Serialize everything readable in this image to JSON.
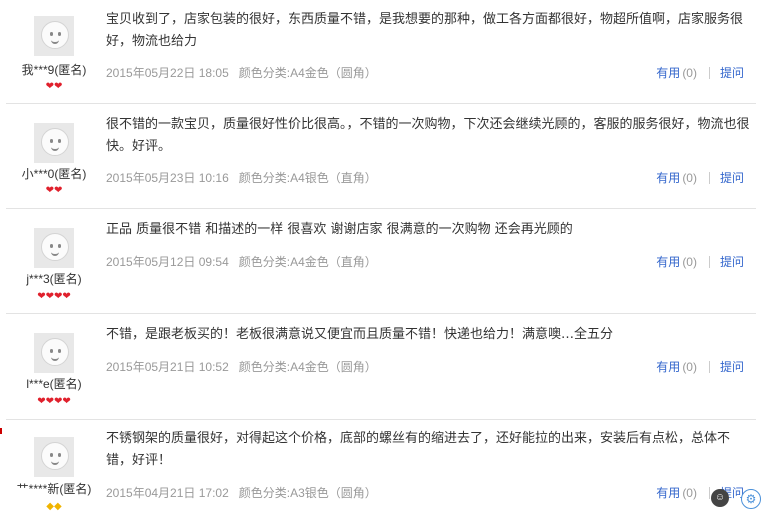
{
  "reviews": [
    {
      "nick": "我***9(匿名)",
      "rank": "hearts",
      "rank_icons": [
        "heart",
        "heart"
      ],
      "content": "宝贝收到了，店家包装的很好，东西质量不错，是我想要的那种，做工各方面都很好，物超所值啊，店家服务很好，物流也给力",
      "date": "2015年05月22日 18:05",
      "sku": "颜色分类:A4金色（圆角）",
      "useful_label": "有用",
      "useful_count": "(0)",
      "ask_label": "提问"
    },
    {
      "nick": "小***0(匿名)",
      "rank": "hearts",
      "rank_icons": [
        "heart",
        "heart"
      ],
      "content": "很不错的一款宝贝，质量很好性价比很高。，不错的一次购物，下次还会继续光顾的，客服的服务很好，物流也很快。好评。",
      "date": "2015年05月23日 10:16",
      "sku": "颜色分类:A4银色（直角）",
      "useful_label": "有用",
      "useful_count": "(0)",
      "ask_label": "提问"
    },
    {
      "nick": "j***3(匿名)",
      "rank": "hearts",
      "rank_icons": [
        "heart",
        "heart",
        "heart",
        "heart"
      ],
      "content": "正品 质量很不错 和描述的一样 很喜欢 谢谢店家 很满意的一次购物 还会再光顾的",
      "date": "2015年05月12日 09:54",
      "sku": "颜色分类:A4金色（直角）",
      "useful_label": "有用",
      "useful_count": "(0)",
      "ask_label": "提问"
    },
    {
      "nick": "l***e(匿名)",
      "rank": "hearts",
      "rank_icons": [
        "heart",
        "heart",
        "heart",
        "heart"
      ],
      "content": "不错，是跟老板买的！老板很满意说又便宜而且质量不错！快递也给力！满意噢…全五分",
      "date": "2015年05月21日 10:52",
      "sku": "颜色分类:A4金色（圆角）",
      "useful_label": "有用",
      "useful_count": "(0)",
      "ask_label": "提问"
    },
    {
      "nick": "艹****新(匿名)",
      "rank": "diamonds",
      "rank_icons": [
        "diamond",
        "diamond"
      ],
      "content": "不锈钢架的质量很好，对得起这个价格，底部的螺丝有的缩进去了，还好能拉的出来，安装后有点松，总体不错，好评！",
      "date": "2015年04月21日 17:02",
      "sku": "颜色分类:A3银色（圆角）",
      "useful_label": "有用",
      "useful_count": "(0)",
      "ask_label": "提问"
    }
  ],
  "colors": {
    "link": "#3366cc",
    "muted": "#999999",
    "heart": "#e0202c",
    "diamond": "#f0b400",
    "divider": "#e3e3e3"
  },
  "icons": {
    "heart": "❤",
    "diamond": "◆"
  }
}
